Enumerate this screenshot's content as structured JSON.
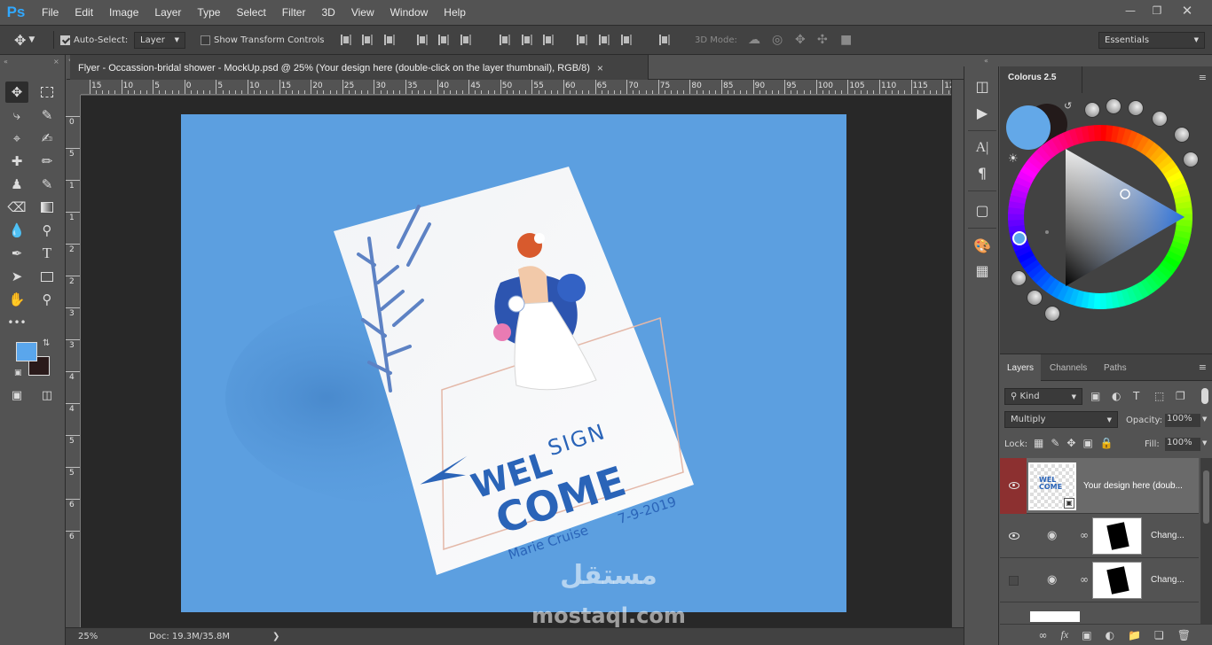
{
  "app": {
    "logo": "Ps",
    "menus": [
      "File",
      "Edit",
      "Image",
      "Layer",
      "Type",
      "Select",
      "Filter",
      "3D",
      "View",
      "Window",
      "Help"
    ]
  },
  "options": {
    "auto_select_label": "Auto-Select:",
    "auto_select_value": "Layer",
    "transform_label": "Show Transform Controls",
    "mode_3d": "3D Mode:",
    "workspace": "Essentials"
  },
  "document": {
    "tab_title": "Flyer - Occassion-bridal shower  - MockUp.psd @ 25% (Your design here (double-click on the layer thumbnail), RGB/8)",
    "close": "×",
    "zoom": "25%",
    "doc_info": "Doc: 19.3M/35.8M"
  },
  "rulers": {
    "top": [
      "15",
      "10",
      "5",
      "0",
      "5",
      "10",
      "15",
      "20",
      "25",
      "30",
      "35",
      "40",
      "45",
      "50",
      "55",
      "60",
      "65",
      "70",
      "75",
      "80",
      "85",
      "90",
      "95",
      "100",
      "105",
      "110",
      "115",
      "12"
    ],
    "left": [
      "0",
      "5",
      "1",
      "1",
      "2",
      "2",
      "3",
      "3",
      "4",
      "4",
      "5",
      "5",
      "6",
      "6"
    ]
  },
  "flyer": {
    "wel": "WEL",
    "sign": "SIGN",
    "come": "COME",
    "name": "Marie Cruise",
    "date": "7-9-2019"
  },
  "watermark": {
    "arabic": "مستقل",
    "latin": "mostaql.com"
  },
  "colorus": {
    "title": "Colorus 2.5",
    "fg": "#63a8e8",
    "bg": "#231a1a"
  },
  "colors": {
    "fg": "#5aa6ec",
    "bg": "#2a1a1a",
    "artboard": "#5c9fe0",
    "flyer_blue": "#2a64b8",
    "active_layer": "#8c3030"
  },
  "layers": {
    "tabs": [
      "Layers",
      "Channels",
      "Paths"
    ],
    "filter_kind": "Kind",
    "blend_mode": "Multiply",
    "opacity_label": "Opacity:",
    "opacity": "100%",
    "lock_label": "Lock:",
    "fill_label": "Fill:",
    "fill": "100%",
    "items": [
      {
        "name": "Your design here (doub...",
        "visible": true,
        "selected": true
      },
      {
        "name": "Chang...",
        "visible": true,
        "selected": false
      },
      {
        "name": "Chang...",
        "visible": false,
        "selected": false
      }
    ]
  }
}
